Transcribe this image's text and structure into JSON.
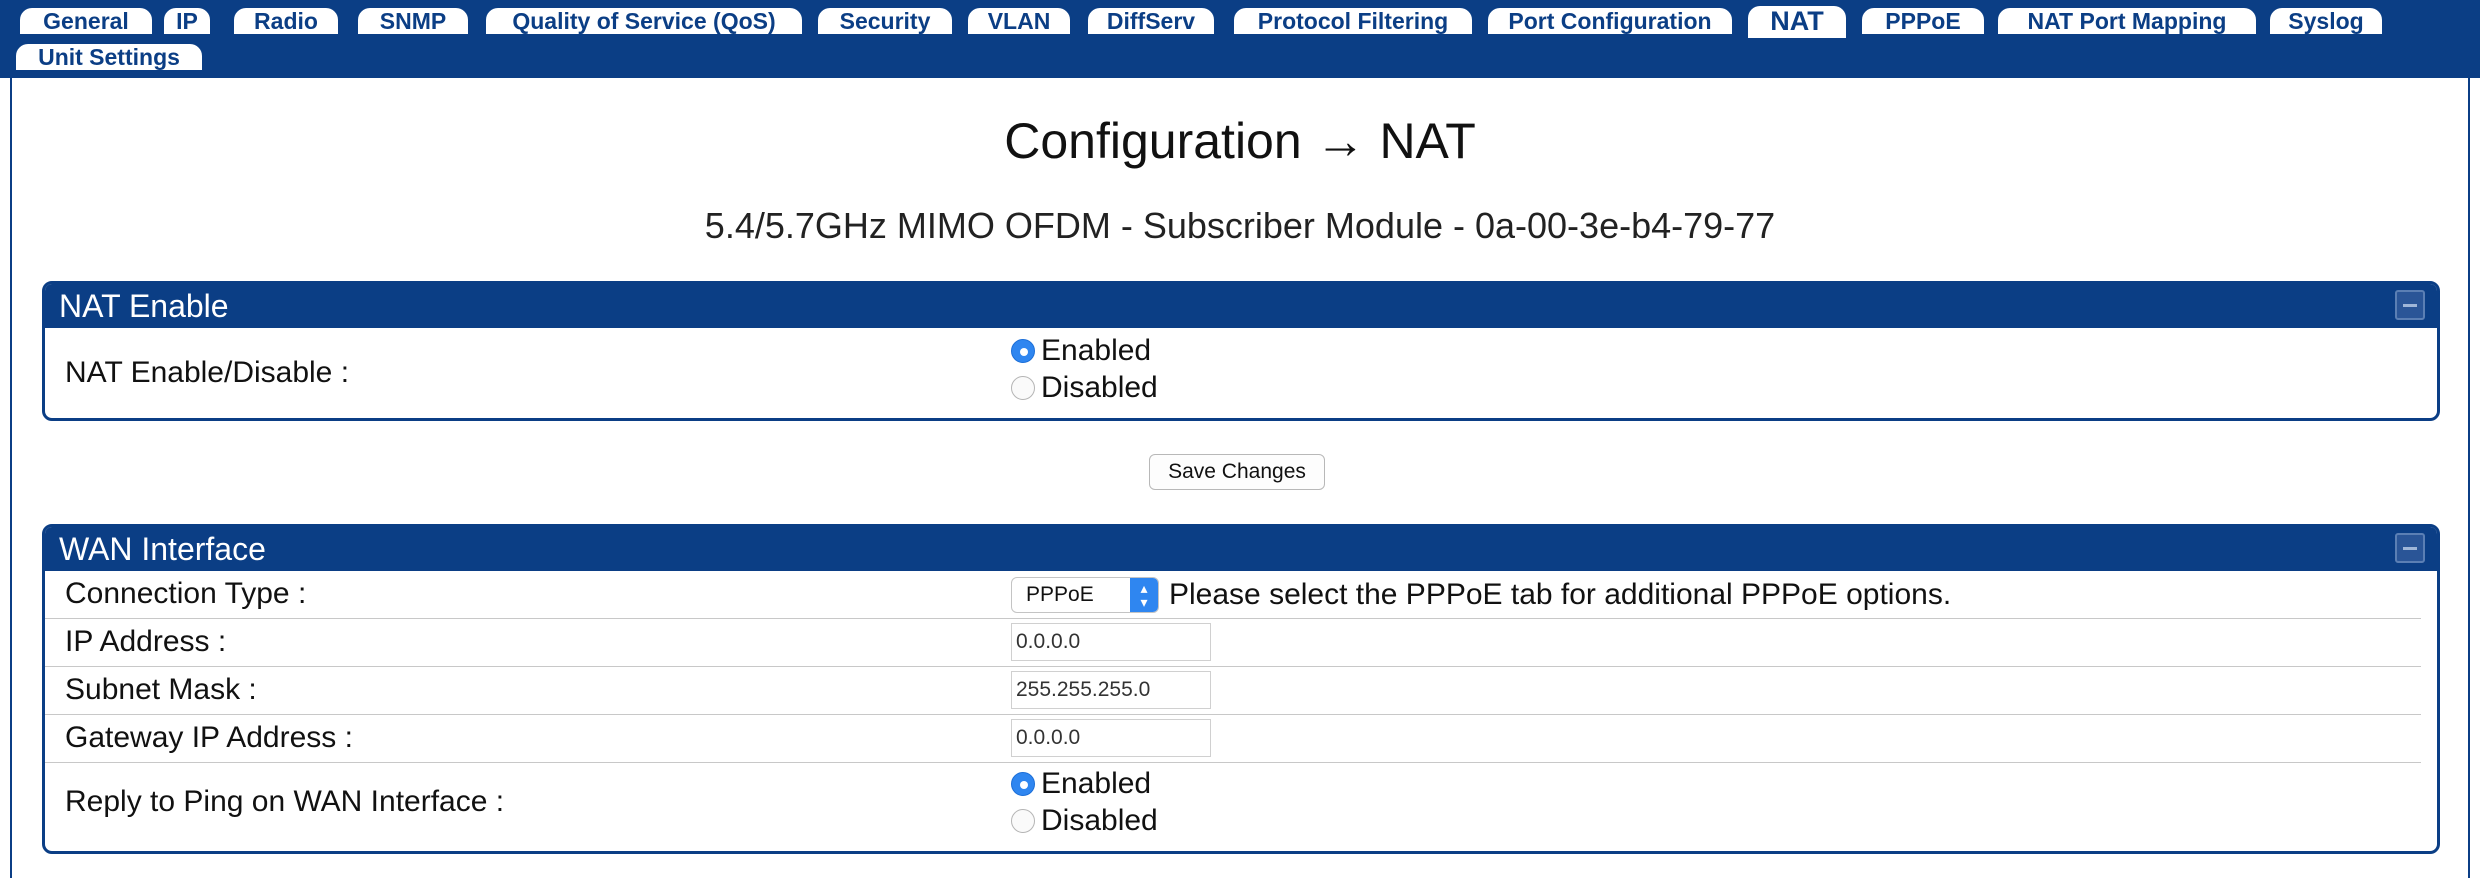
{
  "tabs": [
    {
      "label": "General"
    },
    {
      "label": "IP"
    },
    {
      "label": "Radio"
    },
    {
      "label": "SNMP"
    },
    {
      "label": "Quality of Service (QoS)"
    },
    {
      "label": "Security"
    },
    {
      "label": "VLAN"
    },
    {
      "label": "DiffServ"
    },
    {
      "label": "Protocol Filtering"
    },
    {
      "label": "Port Configuration"
    },
    {
      "label": "NAT",
      "active": true
    },
    {
      "label": "PPPoE"
    },
    {
      "label": "NAT Port Mapping"
    },
    {
      "label": "Syslog"
    },
    {
      "label": "Unit Settings"
    }
  ],
  "page": {
    "title": "Configuration → NAT",
    "subtitle": "5.4/5.7GHz MIMO OFDM - Subscriber Module - 0a-00-3e-b4-79-77"
  },
  "nat_enable": {
    "header": "NAT Enable",
    "label": "NAT Enable/Disable :",
    "options": [
      "Enabled",
      "Disabled"
    ],
    "selected": "Enabled"
  },
  "save_button": "Save Changes",
  "wan": {
    "header": "WAN Interface",
    "connection_type_label": "Connection Type :",
    "connection_type_value": "PPPoE",
    "connection_type_hint": "Please select the PPPoE tab for additional PPPoE options.",
    "ip_label": "IP Address :",
    "ip_value": "0.0.0.0",
    "subnet_label": "Subnet Mask :",
    "subnet_value": "255.255.255.0",
    "gateway_label": "Gateway IP Address :",
    "gateway_value": "0.0.0.0",
    "ping_label": "Reply to Ping on WAN Interface :",
    "ping_options": [
      "Enabled",
      "Disabled"
    ],
    "ping_selected": "Enabled"
  },
  "colors": {
    "brand": "#0b3e85",
    "radio_checked": "#2f86f0"
  }
}
